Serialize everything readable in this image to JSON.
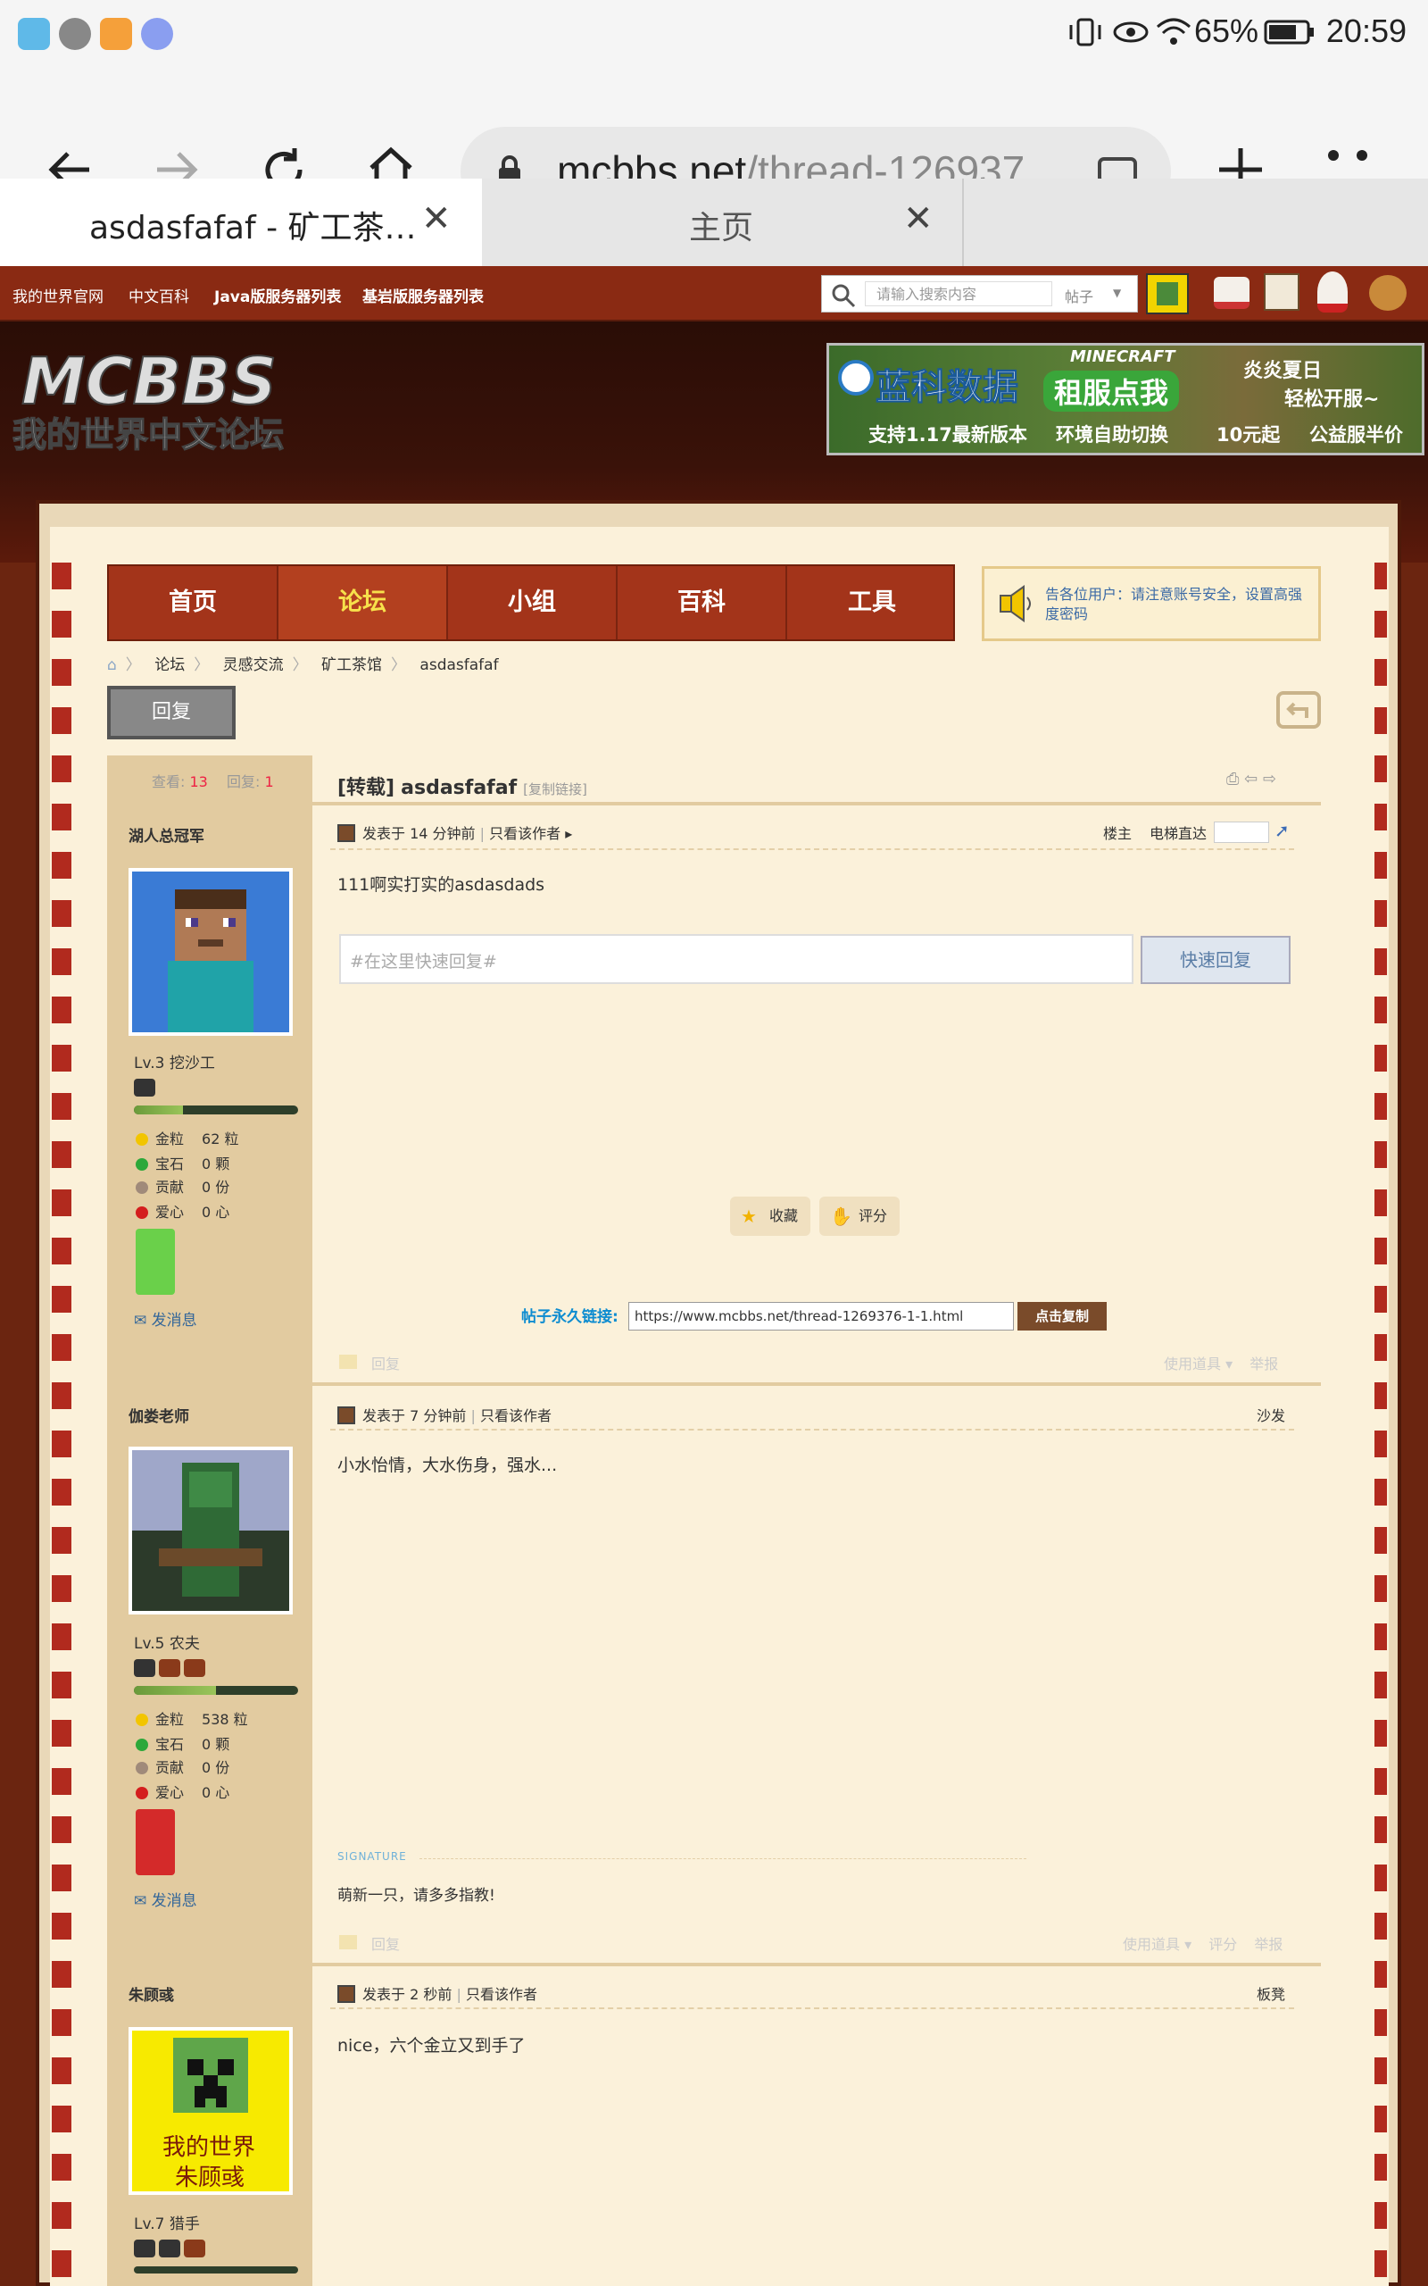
{
  "status_bar": {
    "battery_percent": "65%",
    "time": "20:59"
  },
  "browser": {
    "url_host": "mcbbs.net",
    "url_path": "/thread-126937",
    "tabs": [
      {
        "title": "asdasfafaf - 矿工茶…",
        "close": "✕"
      },
      {
        "title": "主页",
        "close": "✕"
      }
    ]
  },
  "site": {
    "top_nav": [
      "我的世界官网",
      "中文百科",
      "Java版服务器列表",
      "基岩版服务器列表"
    ],
    "search_placeholder": "请输入搜索内容",
    "search_type": "帖子",
    "ad": {
      "brand": "蓝科数据",
      "cta": "租服点我",
      "tagline1": "炎炎夏日",
      "tagline2": "轻松开服~",
      "bottom": [
        "支持1.17最新版本",
        "环境自助切换",
        "10元起",
        "公益服半价"
      ],
      "game": "MINECRAFT"
    },
    "main_nav": [
      "首页",
      "论坛",
      "小组",
      "百科",
      "工具"
    ],
    "main_nav_active": 1,
    "notice": "告各位用户：请注意账号安全，设置高强度密码",
    "breadcrumb": [
      "论坛",
      "灵感交流",
      "矿工茶馆",
      "asdasfafaf"
    ],
    "reply_button": "回复"
  },
  "thread": {
    "views_label": "查看:",
    "views": "13",
    "replies_label": "回复:",
    "replies": "1",
    "title_prefix": "[转载]",
    "title": "asdasfafaf",
    "copy_link": "[复制链接]",
    "quick_reply_placeholder": "#在这里快速回复#",
    "quick_reply_button": "快速回复",
    "favorite": "收藏",
    "rate": "评分",
    "permalink_label": "帖子永久链接:",
    "permalink": "https://www.mcbbs.net/thread-1269376-1-1.html",
    "copy_button": "点击复制",
    "elevator_label": "电梯直达",
    "signature_label": "SIGNATURE"
  },
  "posts": [
    {
      "author": "湖人总冠军",
      "level": "Lv.3 挖沙工",
      "level_progress": 0.3,
      "stats": [
        {
          "label": "金粒",
          "value": "62 粒"
        },
        {
          "label": "宝石",
          "value": "0 颗"
        },
        {
          "label": "贡献",
          "value": "0 份"
        },
        {
          "label": "爱心",
          "value": "0 心"
        }
      ],
      "pm": "发消息",
      "time": "发表于 14 分钟前",
      "only_author": "只看该作者",
      "floor": "楼主",
      "content": "111啊实打实的asdasdads",
      "footer": {
        "reply": "回复",
        "tools": "使用道具",
        "report": "举报"
      }
    },
    {
      "author": "伽娄老师",
      "level": "Lv.5 农夫",
      "level_progress": 0.5,
      "stats": [
        {
          "label": "金粒",
          "value": "538 粒"
        },
        {
          "label": "宝石",
          "value": "0 颗"
        },
        {
          "label": "贡献",
          "value": "0 份"
        },
        {
          "label": "爱心",
          "value": "0 心"
        }
      ],
      "pm": "发消息",
      "time": "发表于 7 分钟前",
      "only_author": "只看该作者",
      "floor": "沙发",
      "content": "小水怡情，大水伤身，强水...",
      "signature": "萌新一只，请多多指教!",
      "footer": {
        "reply": "回复",
        "tools": "使用道具",
        "rate": "评分",
        "report": "举报"
      }
    },
    {
      "author": "朱顾彧",
      "level": "Lv.7 猎手",
      "avatar_text1": "我的世界",
      "avatar_text2": "朱顾彧",
      "time": "发表于 2 秒前",
      "only_author": "只看该作者",
      "floor": "板凳",
      "content": "nice，六个金立又到手了"
    }
  ],
  "colors": {
    "brand_red": "#a3341a",
    "active_nav": "#f7e14b",
    "paper": "#fbf1da",
    "link_blue": "#336699"
  },
  "icons": [
    "search-icon",
    "back-icon",
    "forward-icon",
    "reload-icon",
    "home-icon",
    "lock-icon",
    "tabs-icon",
    "new-tab-icon",
    "menu-icon",
    "speaker-icon",
    "star-icon",
    "thumb-icon",
    "mail-icon",
    "print-icon",
    "prev-icon",
    "next-icon",
    "return-icon"
  ]
}
